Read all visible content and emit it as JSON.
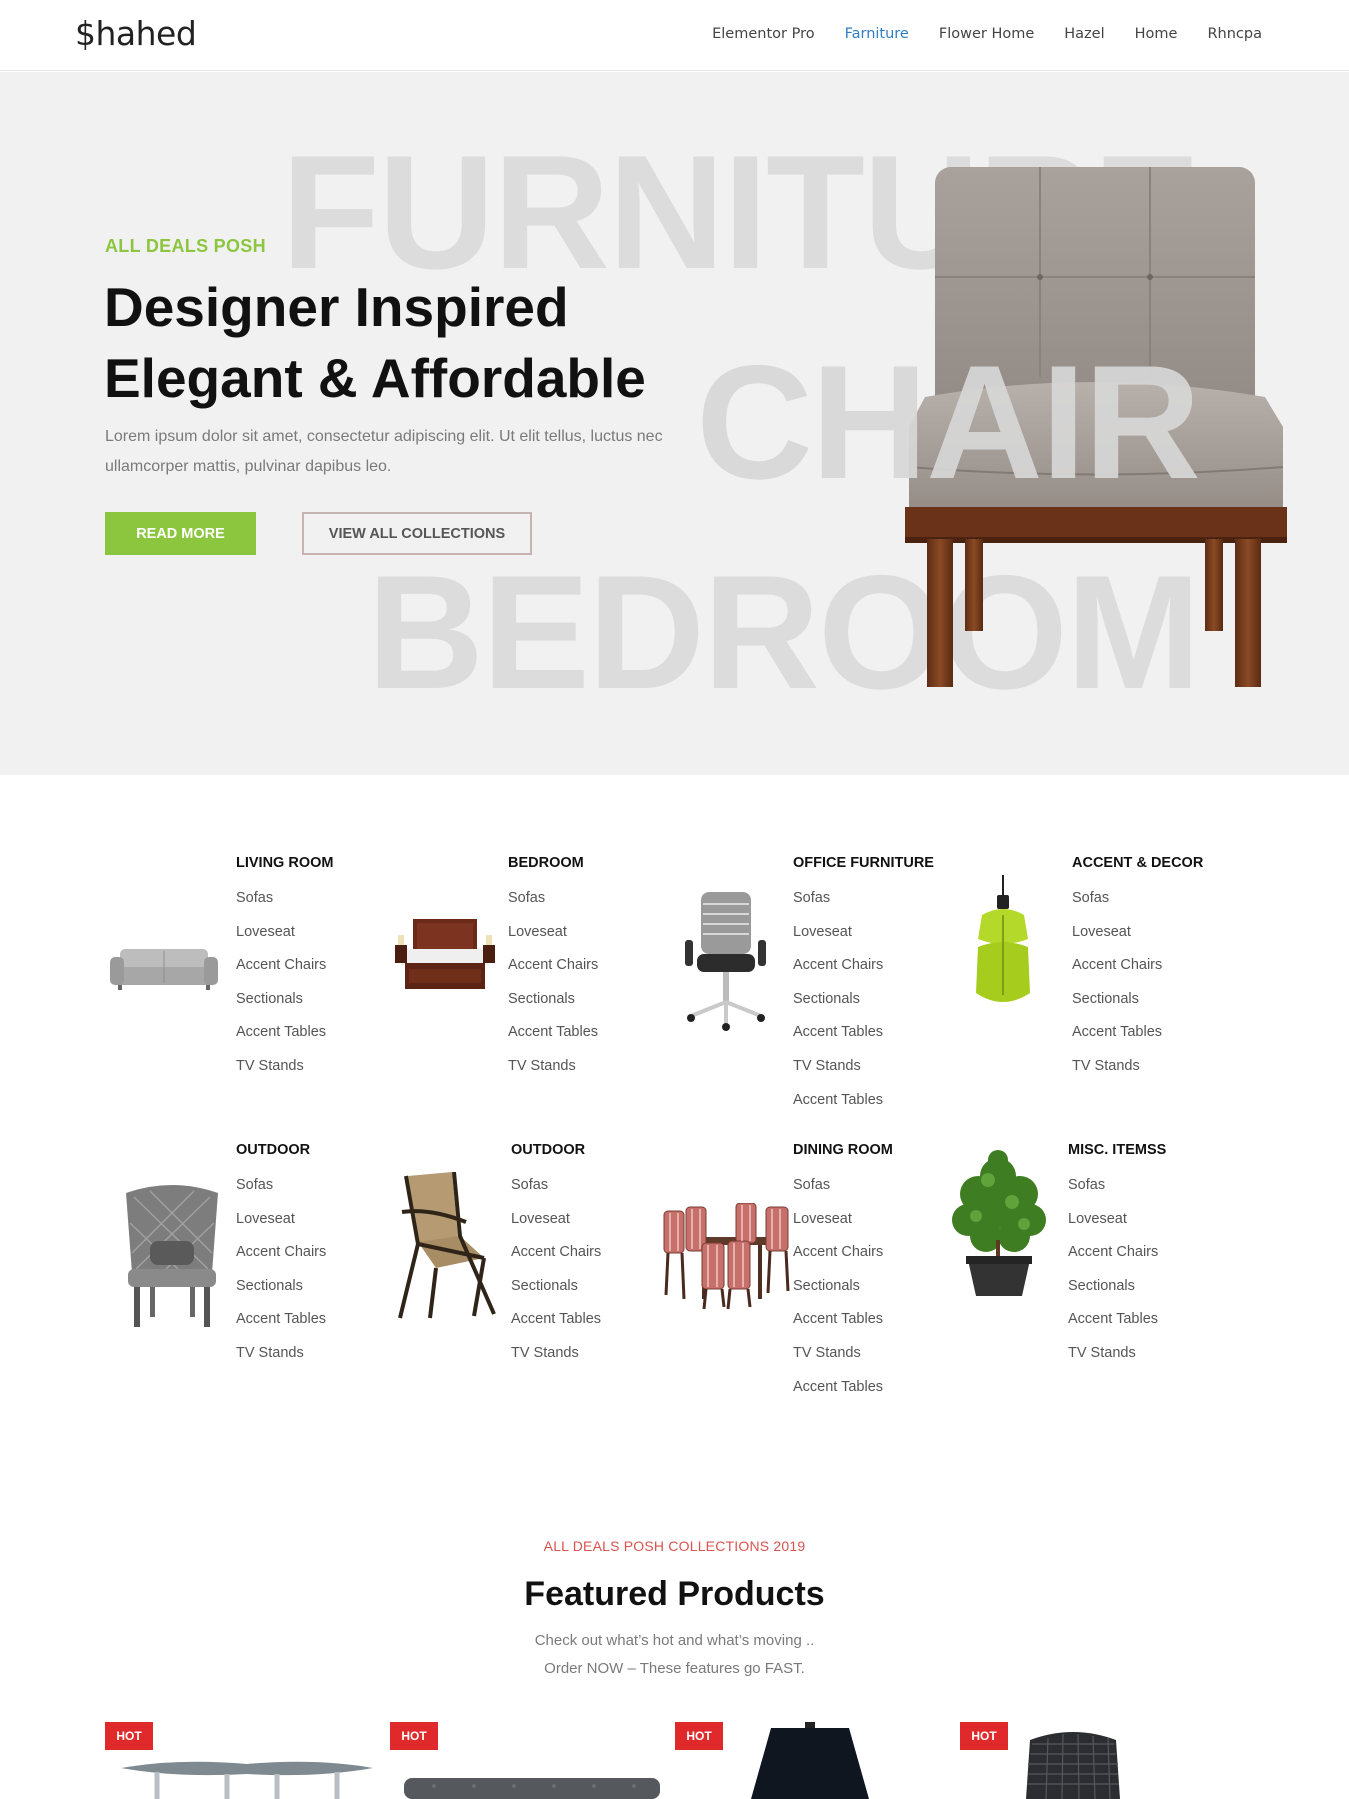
{
  "header": {
    "logo": "$hahed",
    "nav": [
      "Elementor Pro",
      "Farniture",
      "Flower Home",
      "Hazel",
      "Home",
      "Rhncpa"
    ],
    "active_nav": "Farniture"
  },
  "hero": {
    "bg_words": [
      "FURNITURE",
      "CHAIR",
      "BEDROOM"
    ],
    "kicker": "ALL DEALS POSH",
    "title_line1": "Designer Inspired",
    "title_line2": "Elegant & Affordable",
    "lead": "Lorem ipsum dolor sit amet, consectetur adipiscing elit. Ut elit tellus, luctus nec ullamcorper mattis, pulvinar dapibus leo.",
    "btn_read": "READ MORE",
    "btn_view": "VIEW ALL COLLECTIONS"
  },
  "categories": [
    {
      "title": "LIVING ROOM",
      "icon": "sofa-icon",
      "items": [
        "Sofas",
        "Loveseat",
        "Accent Chairs",
        "Sectionals",
        "Accent Tables",
        "TV Stands"
      ]
    },
    {
      "title": "BEDROOM",
      "icon": "bed-icon",
      "items": [
        "Sofas",
        "Loveseat",
        "Accent Chairs",
        "Sectionals",
        "Accent Tables",
        "TV Stands"
      ]
    },
    {
      "title": "OFFICE FURNITURE",
      "icon": "office-chair-icon",
      "items": [
        "Sofas",
        "Loveseat",
        "Accent Chairs",
        "Sectionals",
        "Accent Tables",
        "TV Stands",
        "Accent Tables"
      ]
    },
    {
      "title": "ACCENT & DECOR",
      "icon": "pendant-lamp-icon",
      "items": [
        "Sofas",
        "Loveseat",
        "Accent Chairs",
        "Sectionals",
        "Accent Tables",
        "TV Stands"
      ]
    },
    {
      "title": "OUTDOOR",
      "icon": "wicker-chair-icon",
      "items": [
        "Sofas",
        "Loveseat",
        "Accent Chairs",
        "Sectionals",
        "Accent Tables",
        "TV Stands"
      ]
    },
    {
      "title": "OUTDOOR",
      "icon": "patio-chair-icon",
      "items": [
        "Sofas",
        "Loveseat",
        "Accent Chairs",
        "Sectionals",
        "Accent Tables",
        "TV Stands"
      ]
    },
    {
      "title": "DINING ROOM",
      "icon": "dining-set-icon",
      "items": [
        "Sofas",
        "Loveseat",
        "Accent Chairs",
        "Sectionals",
        "Accent Tables",
        "TV Stands",
        "Accent Tables"
      ]
    },
    {
      "title": "MISC. ITEMSS",
      "icon": "potted-plant-icon",
      "items": [
        "Sofas",
        "Loveseat",
        "Accent Chairs",
        "Sectionals",
        "Accent Tables",
        "TV Stands"
      ]
    }
  ],
  "featured": {
    "kicker": "ALL DEALS POSH COLLECTIONS 2019",
    "title": "Featured Products",
    "sub_line1": "Check out what’s hot and what’s moving ..",
    "sub_line2": "Order NOW – These features go FAST.",
    "badge": "HOT",
    "products": [
      {
        "icon": "glass-table-icon"
      },
      {
        "icon": "gray-sofa-icon"
      },
      {
        "icon": "lamp-shade-icon"
      },
      {
        "icon": "mesh-chair-icon"
      }
    ]
  },
  "colors": {
    "accent_green": "#8cc63f",
    "nav_active": "#2f7dc4",
    "hot_red": "#e0292b",
    "kicker_red": "#d9534f"
  }
}
